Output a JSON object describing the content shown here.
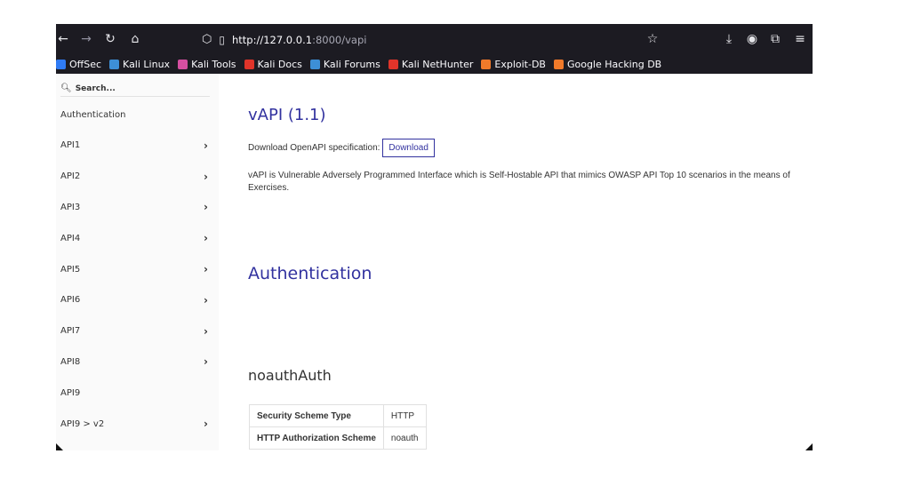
{
  "browser": {
    "url_host": "http://127.0.0.1",
    "url_path": ":8000/vapi",
    "icons": {
      "back": "arrow-left",
      "forward": "arrow-right",
      "reload": "reload",
      "home": "home",
      "shield": "tracking-shield",
      "page": "page",
      "star": "star",
      "download": "download",
      "account": "account",
      "extensions": "extensions",
      "menu": "hamburger-menu"
    }
  },
  "bookmarks": [
    {
      "label": "OffSec",
      "icon_color": "#2f7bf5"
    },
    {
      "label": "Kali Linux",
      "icon_color": "#3d8fd6"
    },
    {
      "label": "Kali Tools",
      "icon_color": "#d64fa1"
    },
    {
      "label": "Kali Docs",
      "icon_color": "#e0342a"
    },
    {
      "label": "Kali Forums",
      "icon_color": "#3d8fd6"
    },
    {
      "label": "Kali NetHunter",
      "icon_color": "#e0342a"
    },
    {
      "label": "Exploit-DB",
      "icon_color": "#f07a2a"
    },
    {
      "label": "Google Hacking DB",
      "icon_color": "#f07a2a"
    }
  ],
  "sidebar": {
    "search_placeholder": "Search...",
    "items": [
      {
        "label": "Authentication",
        "chevron": false
      },
      {
        "label": "API1",
        "chevron": true
      },
      {
        "label": "API2",
        "chevron": true
      },
      {
        "label": "API3",
        "chevron": true
      },
      {
        "label": "API4",
        "chevron": true
      },
      {
        "label": "API5",
        "chevron": true
      },
      {
        "label": "API6",
        "chevron": true
      },
      {
        "label": "API7",
        "chevron": true
      },
      {
        "label": "API8",
        "chevron": true
      },
      {
        "label": "API9",
        "chevron": false
      },
      {
        "label": "API9 > v2",
        "chevron": true
      }
    ]
  },
  "main": {
    "title": "vAPI (1.1)",
    "download_label": "Download OpenAPI specification:",
    "download_button": "Download",
    "description": "vAPI is Vulnerable Adversely Programmed Interface which is Self-Hostable API that mimics OWASP API Top 10 scenarios in the means of Exercises.",
    "section_heading": "Authentication",
    "scheme_name": "noauthAuth",
    "scheme_table": [
      {
        "key": "Security Scheme Type",
        "value": "HTTP"
      },
      {
        "key": "HTTP Authorization Scheme",
        "value": "noauth"
      }
    ]
  },
  "colors": {
    "accent": "#32329f",
    "toolbar_bg": "#1c1b22"
  }
}
